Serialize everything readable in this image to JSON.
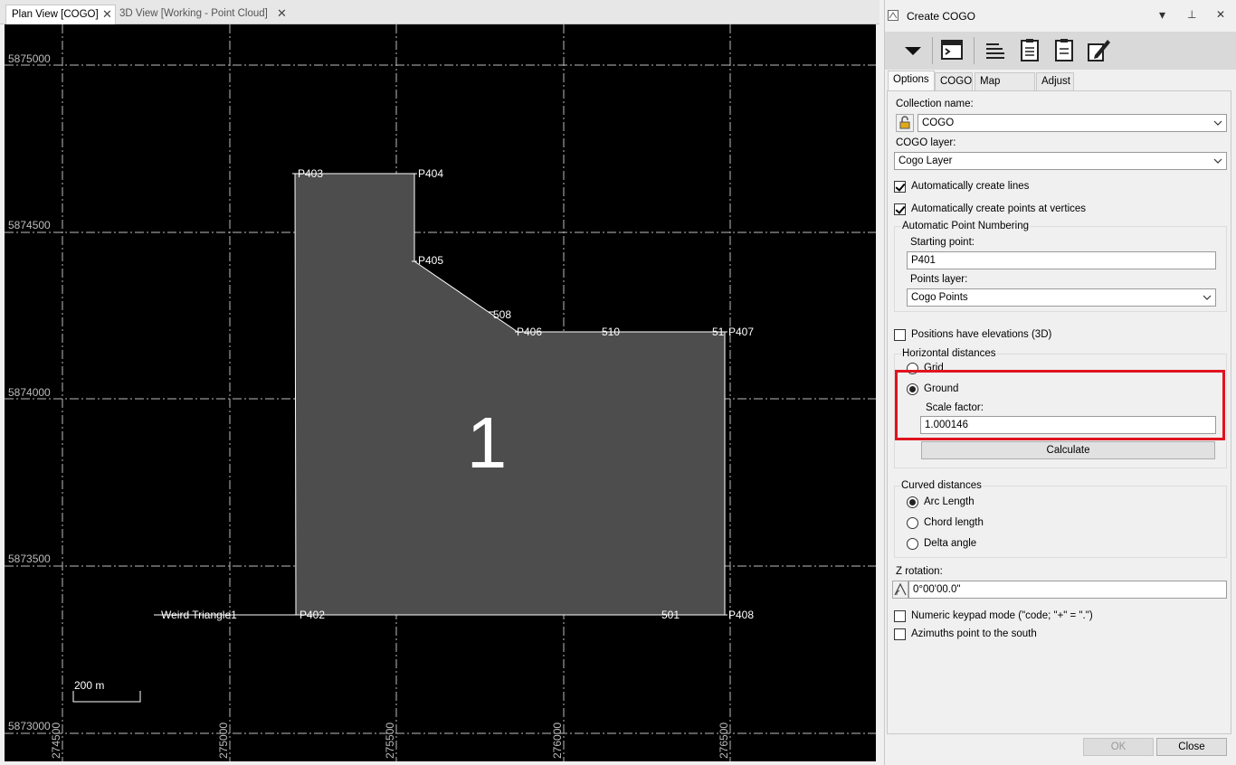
{
  "tabs": {
    "plan": {
      "label": "Plan View [COGO]",
      "close": "✕"
    },
    "view3d": {
      "label": "3D View [Working - Point Cloud]",
      "close": "✕"
    }
  },
  "plan": {
    "northing_labels": [
      "5875000",
      "5874500",
      "5874000",
      "5873500",
      "5873000"
    ],
    "easting_labels": [
      "274500",
      "275000",
      "275500",
      "276000",
      "276500"
    ],
    "point_labels": [
      "P403",
      "P404",
      "P405",
      "508",
      "P406",
      "510",
      "51",
      "P407",
      "P402",
      "501",
      "P408"
    ],
    "line_label": "Weird Triangle1",
    "parcel_label": "1",
    "scale_label": "200 m",
    "colors": {
      "background": "#000000",
      "parcel_fill": "#4d4d4d",
      "lines": "#ffffff",
      "grid": "#bfbfbf"
    }
  },
  "panel": {
    "title": "Create COGO",
    "title_buttons": {
      "dropdown": "▾",
      "pin": "⊥",
      "close": "✕"
    },
    "toolbar_icons": [
      "dropdown-arrow-icon",
      "terminal-icon",
      "lines-list-icon",
      "clipboard-icon",
      "clipboard-check-icon",
      "edit-pencil-icon"
    ],
    "tabs": [
      "Options",
      "COGO",
      "Map Check",
      "Adjust"
    ],
    "active_tab": "Options",
    "collection_name_label": "Collection name:",
    "collection_name_value": "COGO",
    "cogo_layer_label": "COGO layer:",
    "cogo_layer_value": "Cogo Layer",
    "auto_lines_label": "Automatically create lines",
    "auto_lines_checked": true,
    "auto_points_label": "Automatically create points at vertices",
    "auto_points_checked": true,
    "numbering_group_label": "Automatic Point Numbering",
    "starting_point_label": "Starting point:",
    "starting_point_value": "P401",
    "points_layer_label": "Points layer:",
    "points_layer_value": "Cogo Points",
    "elevations_label": "Positions have elevations (3D)",
    "elevations_checked": false,
    "horizontal_group_label": "Horizontal distances",
    "grid_label": "Grid",
    "ground_label": "Ground",
    "horizontal_selected": "Ground",
    "scale_factor_label": "Scale factor:",
    "scale_factor_value": "1.000146",
    "calculate_label": "Calculate",
    "curved_group_label": "Curved distances",
    "arc_length_label": "Arc Length",
    "chord_length_label": "Chord length",
    "delta_angle_label": "Delta angle",
    "curved_selected": "Arc Length",
    "z_rotation_label": "Z rotation:",
    "z_rotation_value": "0°00'00.0\"",
    "numeric_keypad_label": "Numeric keypad mode (\"code; \"+\" = \".\")",
    "numeric_keypad_checked": false,
    "azimuths_label": "Azimuths point to the south",
    "azimuths_checked": false,
    "ok_label": "OK",
    "close_label": "Close",
    "highlight_color": "#e0141e"
  }
}
